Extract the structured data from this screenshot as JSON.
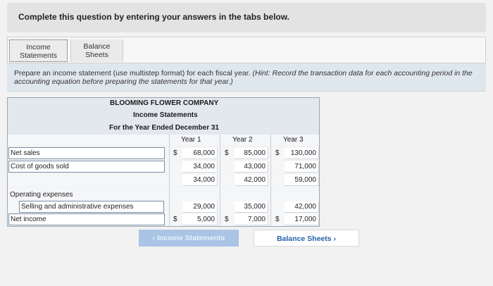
{
  "question": {
    "text": "Complete this question by entering your answers in the tabs below."
  },
  "tabs": [
    {
      "line1": "Income",
      "line2": "Statements"
    },
    {
      "line1": "Balance",
      "line2": "Sheets"
    }
  ],
  "instructions": {
    "part1": "Prepare an income statement (use multistep format) for each fiscal year.",
    "hint": "(Hint: Record the transaction data for each accounting period in the accounting equation before preparing the statements for that year.)"
  },
  "statement": {
    "company": "BLOOMING FLOWER COMPANY",
    "title": "Income Statements",
    "period": "For the Year Ended December 31",
    "years": [
      "Year 1",
      "Year 2",
      "Year 3"
    ],
    "currency": "$",
    "rows": {
      "net_sales": {
        "label": "Net sales",
        "values": [
          "68,000",
          "85,000",
          "130,000"
        ]
      },
      "cogs": {
        "label": "Cost of goods sold",
        "values": [
          "34,000",
          "43,000",
          "71,000"
        ]
      },
      "gross": {
        "label": "",
        "values": [
          "34,000",
          "42,000",
          "59,000"
        ]
      },
      "opex_header": {
        "label": "Operating expenses"
      },
      "sga": {
        "label": "Selling and administrative expenses",
        "values": [
          "29,000",
          "35,000",
          "42,000"
        ]
      },
      "net_income": {
        "label": "Net income",
        "values": [
          "5,000",
          "7,000",
          "17,000"
        ]
      }
    }
  },
  "nav": {
    "prev": "Income Statements",
    "next": "Balance Sheets"
  }
}
